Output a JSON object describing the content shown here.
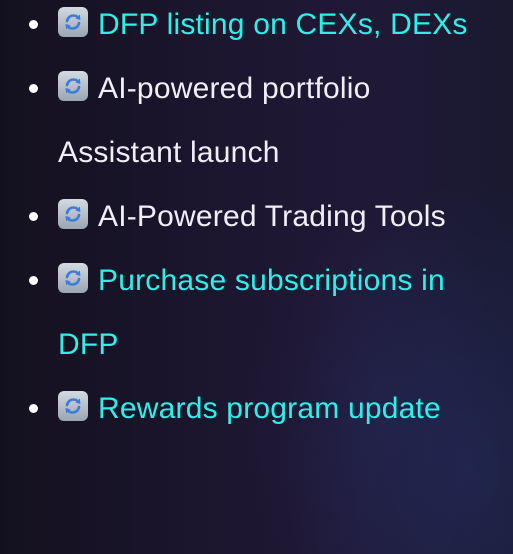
{
  "roadmap_items": [
    {
      "label": "DFP listing on CEXs, DEXs",
      "color": "#2ff0e6",
      "icon": "refresh-icon"
    },
    {
      "label": "AI-powered portfolio Assistant launch",
      "color": "#f1eef8",
      "icon": "refresh-icon"
    },
    {
      "label": "AI-Powered Trading Tools",
      "color": "#f1eef8",
      "icon": "refresh-icon"
    },
    {
      "label": "Purchase subscriptions in DFP",
      "color": "#2ff0e6",
      "icon": "refresh-icon"
    },
    {
      "label": "Rewards program update",
      "color": "#2ff0e6",
      "icon": "refresh-icon"
    }
  ]
}
